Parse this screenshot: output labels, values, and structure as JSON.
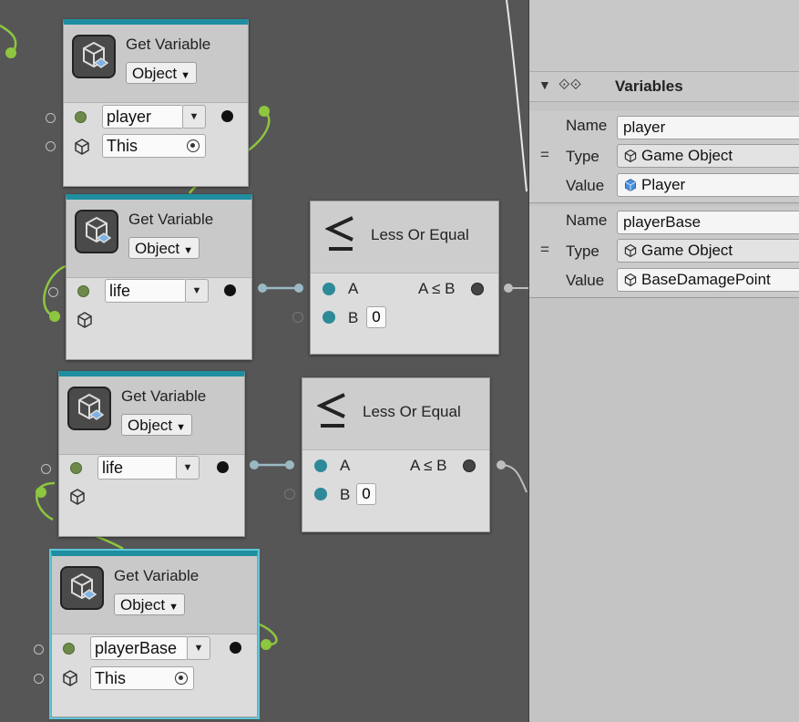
{
  "nodes": {
    "get_var_1": {
      "title": "Get Variable",
      "kind": "Object",
      "variable": "player",
      "target": "This"
    },
    "get_var_2": {
      "title": "Get Variable",
      "kind": "Object",
      "variable": "life"
    },
    "get_var_3": {
      "title": "Get Variable",
      "kind": "Object",
      "variable": "life"
    },
    "get_var_4": {
      "title": "Get Variable",
      "kind": "Object",
      "variable": "playerBase",
      "target": "This"
    },
    "compare_1": {
      "title": "Less Or Equal",
      "input_a": "A",
      "input_b": "B",
      "b_value": "0",
      "output": "A ≤ B"
    },
    "compare_2": {
      "title": "Less Or Equal",
      "input_a": "A",
      "input_b": "B",
      "b_value": "0",
      "output": "A ≤ B"
    }
  },
  "variables_panel": {
    "title": "Variables",
    "labels": {
      "name": "Name",
      "type": "Type",
      "value": "Value"
    },
    "items": [
      {
        "name": "player",
        "type": "Game Object",
        "value": "Player"
      },
      {
        "name": "playerBase",
        "type": "Game Object",
        "value": "BaseDamagePoint"
      }
    ]
  },
  "colors": {
    "node_header_accent": "#1f8ea0",
    "canvas": "#565656",
    "flow_wire": "#8dc63f",
    "bool_wire": "#9ab9c4",
    "teal_port": "#2e8a98"
  }
}
